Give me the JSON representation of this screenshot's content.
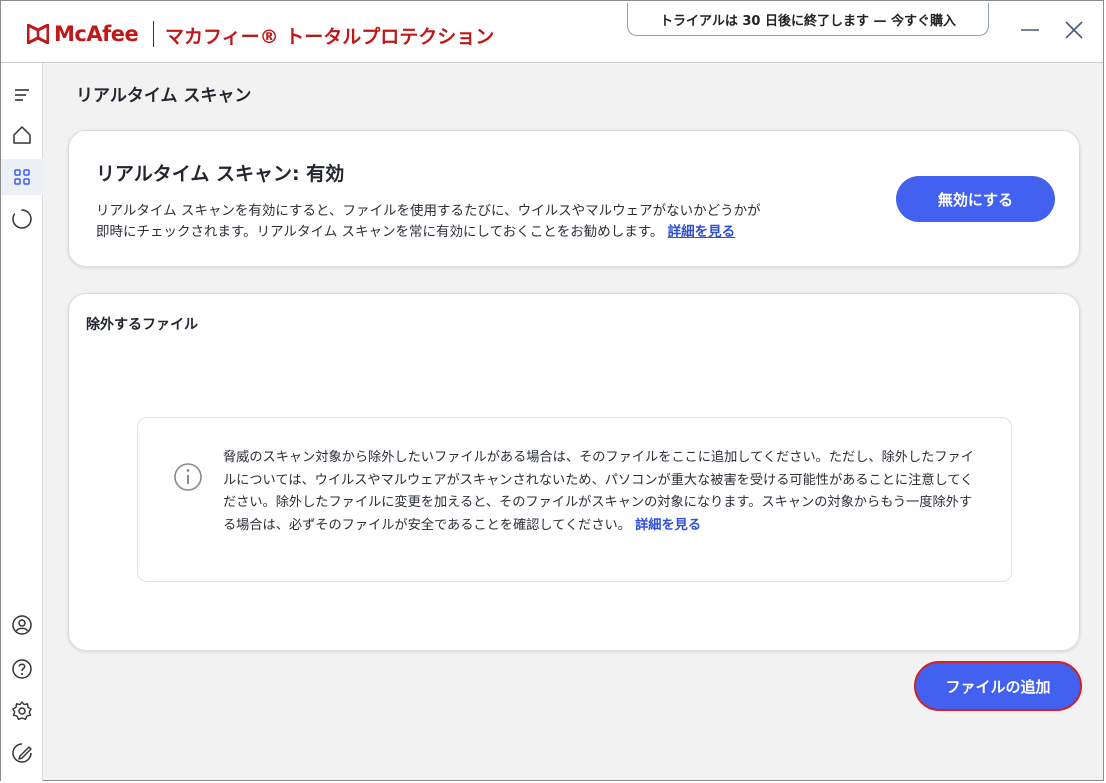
{
  "app": {
    "brand": "McAfee",
    "product_name": "マカフィー® トータルプロテクション",
    "trial_banner": "トライアルは 30 日後に終了します — 今すぐ購入",
    "brand_color": "#c01818"
  },
  "window_controls": {
    "minimize_icon": "minimize-icon",
    "close_icon": "close-icon"
  },
  "sidebar": {
    "items": [
      {
        "icon": "menu-icon"
      },
      {
        "icon": "home-icon"
      },
      {
        "icon": "apps-grid-icon",
        "active": true
      },
      {
        "icon": "circle-loading-icon"
      },
      {
        "icon": "account-icon"
      },
      {
        "icon": "help-icon"
      },
      {
        "icon": "settings-icon"
      },
      {
        "icon": "feedback-icon"
      }
    ]
  },
  "main": {
    "page_title": "リアルタイム スキャン",
    "status_card": {
      "title": "リアルタイム スキャン: 有効",
      "description_line1": "リアルタイム スキャンを有効にすると、ファイルを使用するたびに、ウイルスやマルウェアがないかどうかが",
      "description_line2": "即時にチェックされます。リアルタイム スキャンを常に有効にしておくことをお勧めします。",
      "learn_more": "詳細を見る",
      "disable_button": "無効にする"
    },
    "exclusions_card": {
      "title": "除外するファイル",
      "info_text": "脅威のスキャン対象から除外したいファイルがある場合は、そのファイルをここに追加してください。ただし、除外したファイルについては、ウイルスやマルウェアがスキャンされないため、パソコンが重大な被害を受ける可能性があることに注意してください。除外したファイルに変更を加えると、そのファイルがスキャンの対象になります。スキャンの対象からもう一度除外する場合は、必ずそのファイルが安全であることを確認してください。",
      "learn_more": "詳細を見る"
    },
    "add_file_button": "ファイルの追加"
  },
  "colors": {
    "primary_button": "#4361f0",
    "link": "#2f4fd8",
    "highlight_border": "#d1202b"
  }
}
